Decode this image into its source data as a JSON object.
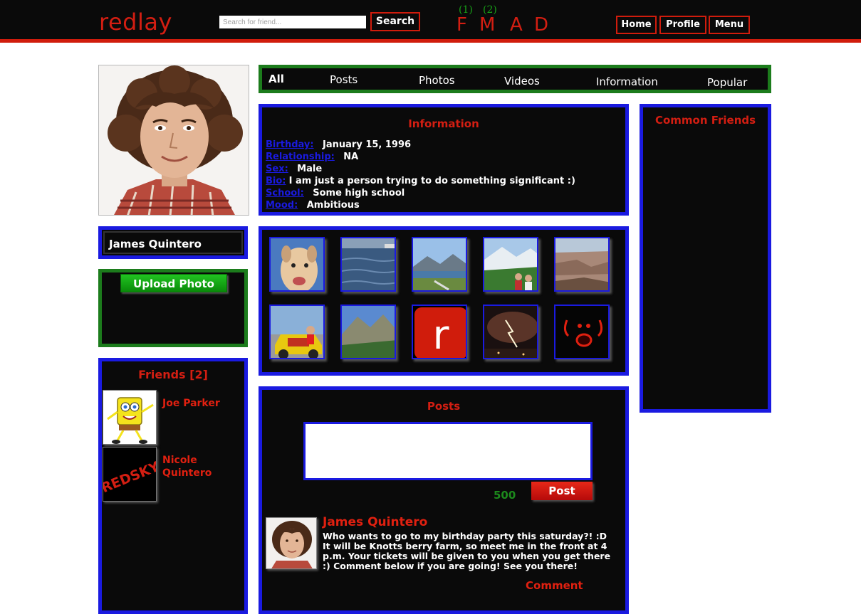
{
  "header": {
    "logo": "redlay",
    "search_placeholder": "Search for friend...",
    "search_button": "Search",
    "fmad": [
      {
        "letter": "F",
        "count": "(1)"
      },
      {
        "letter": "M",
        "count": "(2)"
      },
      {
        "letter": "A",
        "count": ""
      },
      {
        "letter": "D",
        "count": ""
      }
    ],
    "nav": {
      "home": "Home",
      "profile": "Profile",
      "menu": "Menu"
    }
  },
  "profile": {
    "name": "James Quintero",
    "upload_button": "Upload Photo"
  },
  "friends": {
    "title": "Friends [2]",
    "items": [
      {
        "name": "Joe Parker"
      },
      {
        "name": "Nicole Quintero",
        "thumb_text": "REDSKY"
      }
    ]
  },
  "tabs": [
    "All",
    "Posts",
    "Photos",
    "Videos",
    "Information",
    "Popular"
  ],
  "information": {
    "title": "Information",
    "rows": [
      {
        "key": "Birthday:",
        "value": "January 15, 1996"
      },
      {
        "key": "Relationship:",
        "value": "NA"
      },
      {
        "key": "Sex:",
        "value": "Male"
      },
      {
        "key": "Bio:",
        "value": "I am just a person trying to do something significant :)"
      },
      {
        "key": "School:",
        "value": "Some high school"
      },
      {
        "key": "Mood:",
        "value": "Ambitious"
      }
    ]
  },
  "photos": {
    "logo_tile_letter": "r"
  },
  "posts": {
    "title": "Posts",
    "char_count": "500",
    "post_button": "Post",
    "items": [
      {
        "author": "James Quintero",
        "body": "Who wants to go to my birthday party this saturday?! :D It will be Knotts berry farm, so meet me in the front at 4 p.m. Your tickets will be given to you when you get there :) Comment below if you are going! See you there!",
        "comment_label": "Comment"
      }
    ]
  },
  "common_friends": {
    "title": "Common Friends"
  },
  "colors": {
    "brand_red": "#d31e12",
    "panel_blue": "#1a1ae0",
    "panel_green": "#1c7c1c",
    "background": "#0a0a0a"
  }
}
